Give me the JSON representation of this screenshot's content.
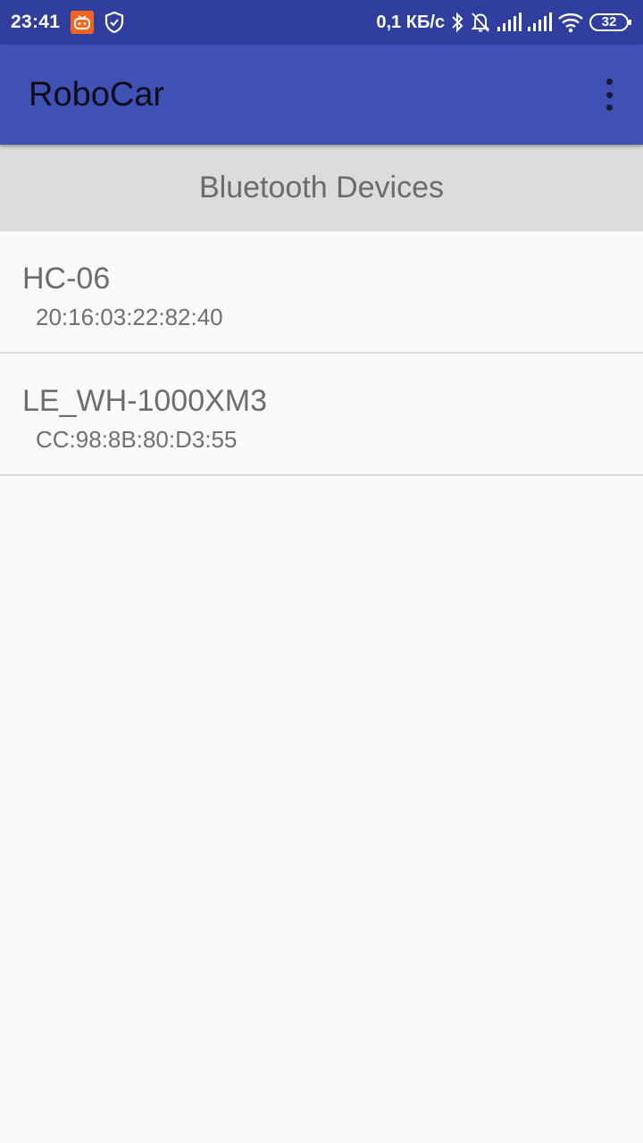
{
  "status_bar": {
    "time": "23:41",
    "network_speed": "0,1 КБ/с",
    "battery_level": "32",
    "left_icons": [
      "notification-app-icon",
      "shield-icon"
    ],
    "right_icons": [
      "bluetooth-icon",
      "bell-off-icon",
      "signal-icon",
      "signal-icon",
      "wifi-icon",
      "battery-icon"
    ]
  },
  "app_bar": {
    "title": "RoboCar",
    "overflow_icon": "more-vertical-icon"
  },
  "section": {
    "title": "Bluetooth Devices"
  },
  "devices": [
    {
      "name": "HC-06",
      "address": "20:16:03:22:82:40"
    },
    {
      "name": "LE_WH-1000XM3",
      "address": "CC:98:8B:80:D3:55"
    }
  ],
  "colors": {
    "status_bar": "#303f9f",
    "app_bar": "#3f51b5",
    "section_header": "#dcdcdc",
    "background": "#fafafa",
    "notification_icon": "#f4661b"
  }
}
